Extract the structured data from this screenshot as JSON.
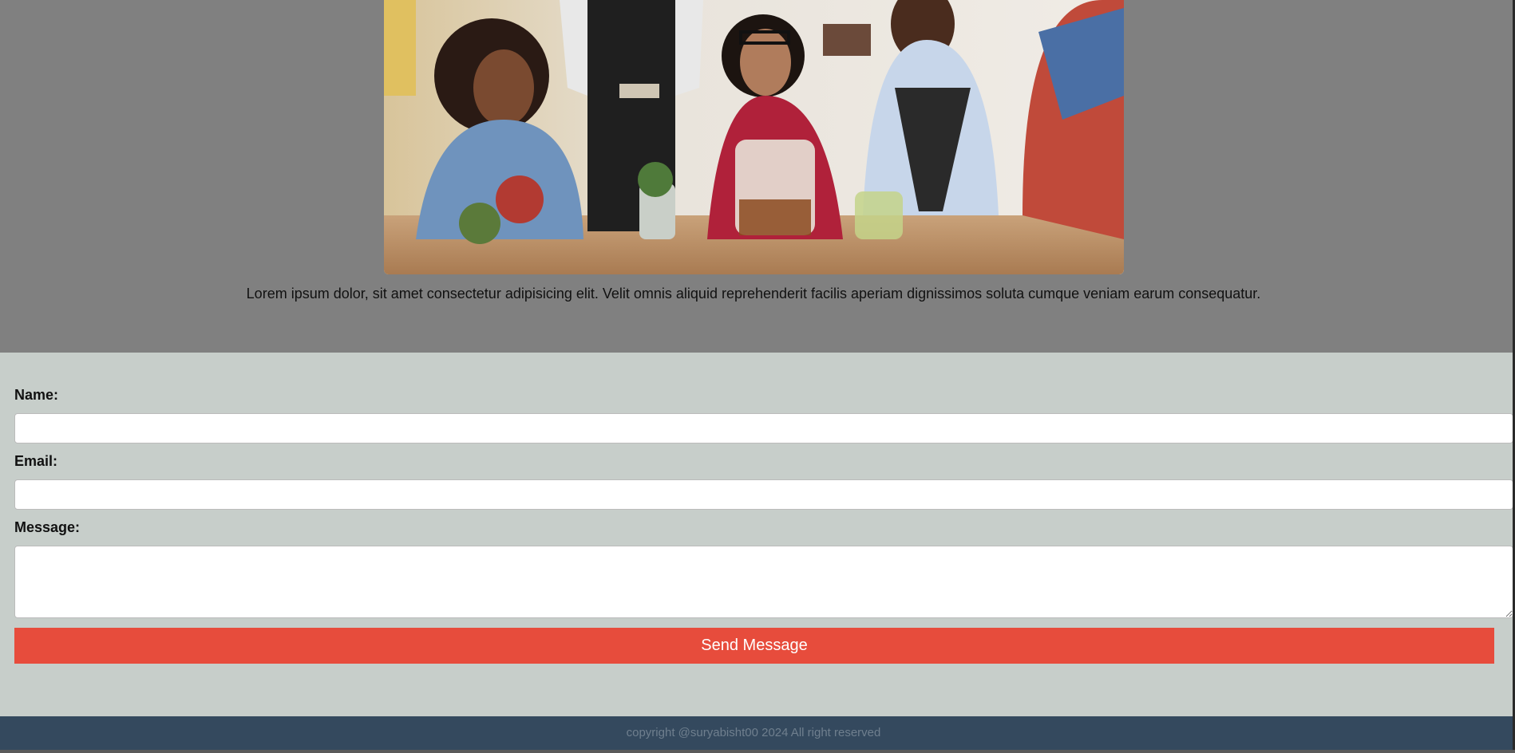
{
  "hero": {
    "image_alt": "Group of friends at a cafe table being served by a waiter",
    "description": "Lorem ipsum dolor, sit amet consectetur adipisicing elit. Velit omnis aliquid reprehenderit facilis aperiam dignissimos soluta cumque veniam earum consequatur."
  },
  "contact_form": {
    "name_label": "Name:",
    "name_value": "",
    "email_label": "Email:",
    "email_value": "",
    "message_label": "Message:",
    "message_value": "",
    "submit_label": "Send Message"
  },
  "footer": {
    "copyright": "copyright @suryabisht00 2024 All right reserved"
  },
  "colors": {
    "hero_bg": "#808080",
    "form_bg": "#c7ceca",
    "button": "#e74c3c",
    "footer_bg": "#34495e"
  }
}
